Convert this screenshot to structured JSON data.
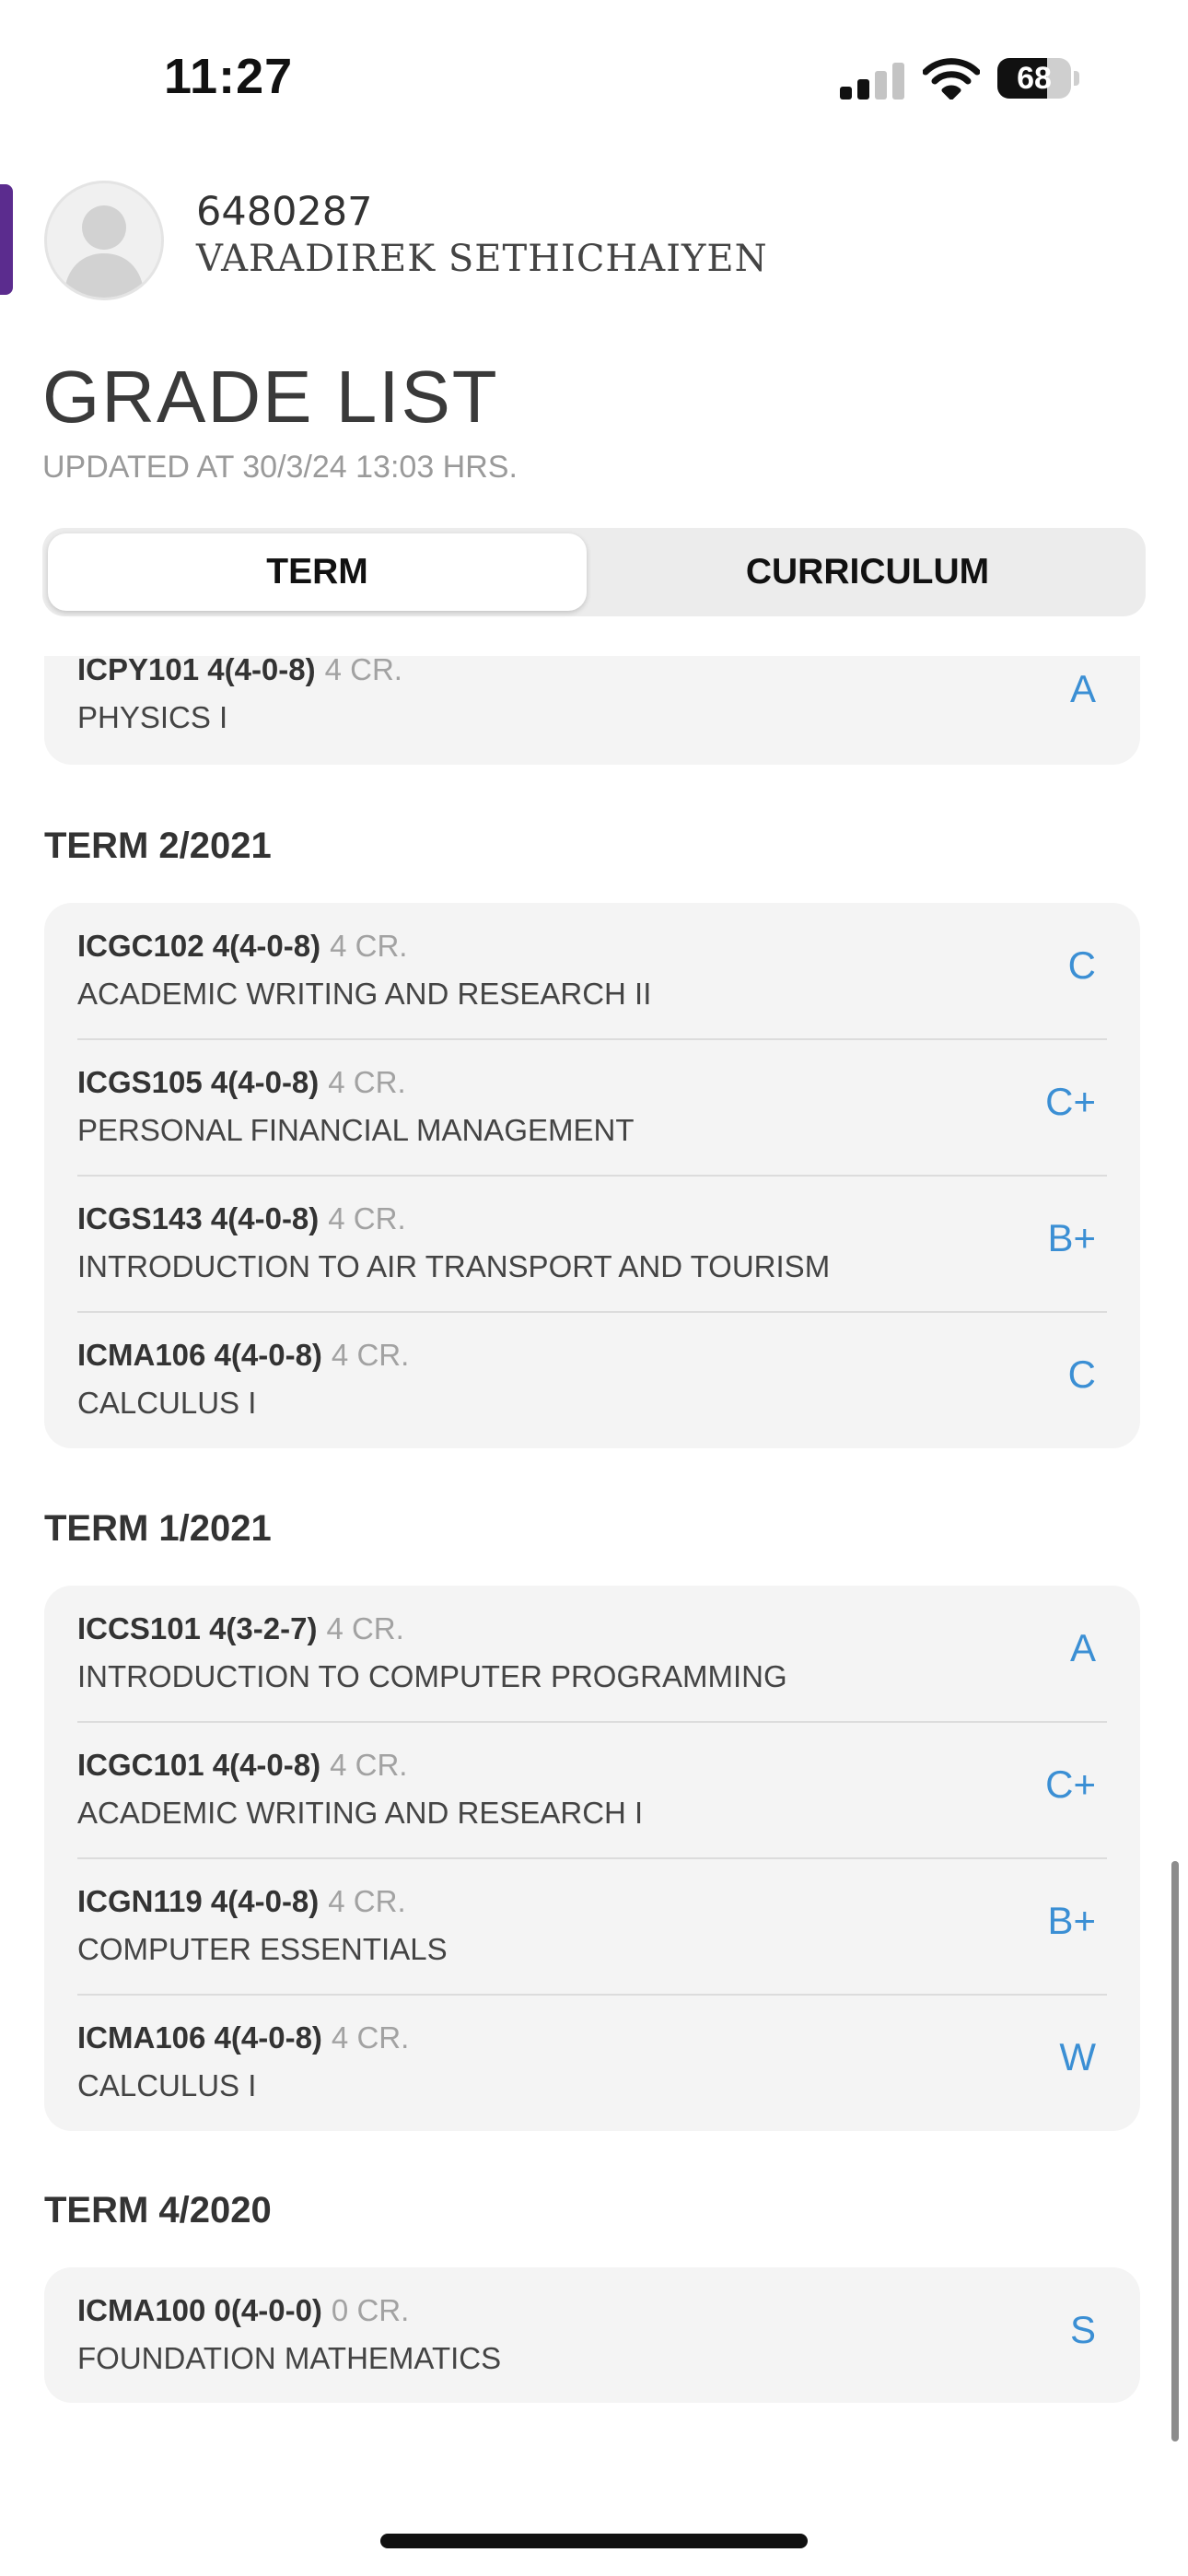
{
  "status_bar": {
    "time": "11:27",
    "battery": "68",
    "battery_level": 0.68
  },
  "profile": {
    "student_id": "6480287",
    "student_name": "VARADIREK SETHICHAIYEN"
  },
  "page": {
    "title": "GRADE LIST",
    "updated": "UPDATED AT 30/3/24 13:03 HRS."
  },
  "tabs": {
    "term": "TERM",
    "curriculum": "CURRICULUM",
    "selected": "TERM"
  },
  "colors": {
    "grade": "#3b8fd4",
    "accent": "#5b2c8e"
  },
  "partial_card": {
    "courses": [
      {
        "code": "ICPY101 4(4-0-8)",
        "credits": "4 CR.",
        "title": "PHYSICS I",
        "grade": "A"
      }
    ]
  },
  "terms": [
    {
      "name": "TERM 2/2021",
      "courses": [
        {
          "code": "ICGC102 4(4-0-8)",
          "credits": "4 CR.",
          "title": "ACADEMIC WRITING AND RESEARCH II",
          "grade": "C"
        },
        {
          "code": "ICGS105 4(4-0-8)",
          "credits": "4 CR.",
          "title": "PERSONAL FINANCIAL MANAGEMENT",
          "grade": "C+"
        },
        {
          "code": "ICGS143 4(4-0-8)",
          "credits": "4 CR.",
          "title": "INTRODUCTION TO AIR TRANSPORT AND TOURISM",
          "grade": "B+"
        },
        {
          "code": "ICMA106 4(4-0-8)",
          "credits": "4 CR.",
          "title": "CALCULUS I",
          "grade": "C"
        }
      ]
    },
    {
      "name": "TERM 1/2021",
      "courses": [
        {
          "code": "ICCS101 4(3-2-7)",
          "credits": "4 CR.",
          "title": "INTRODUCTION TO COMPUTER PROGRAMMING",
          "grade": "A"
        },
        {
          "code": "ICGC101 4(4-0-8)",
          "credits": "4 CR.",
          "title": "ACADEMIC WRITING AND RESEARCH I",
          "grade": "C+"
        },
        {
          "code": "ICGN119 4(4-0-8)",
          "credits": "4 CR.",
          "title": "COMPUTER ESSENTIALS",
          "grade": "B+"
        },
        {
          "code": "ICMA106 4(4-0-8)",
          "credits": "4 CR.",
          "title": "CALCULUS I",
          "grade": "W"
        }
      ]
    },
    {
      "name": "TERM 4/2020",
      "courses": [
        {
          "code": "ICMA100 0(4-0-0)",
          "credits": "0 CR.",
          "title": "FOUNDATION MATHEMATICS",
          "grade": "S"
        }
      ]
    }
  ]
}
